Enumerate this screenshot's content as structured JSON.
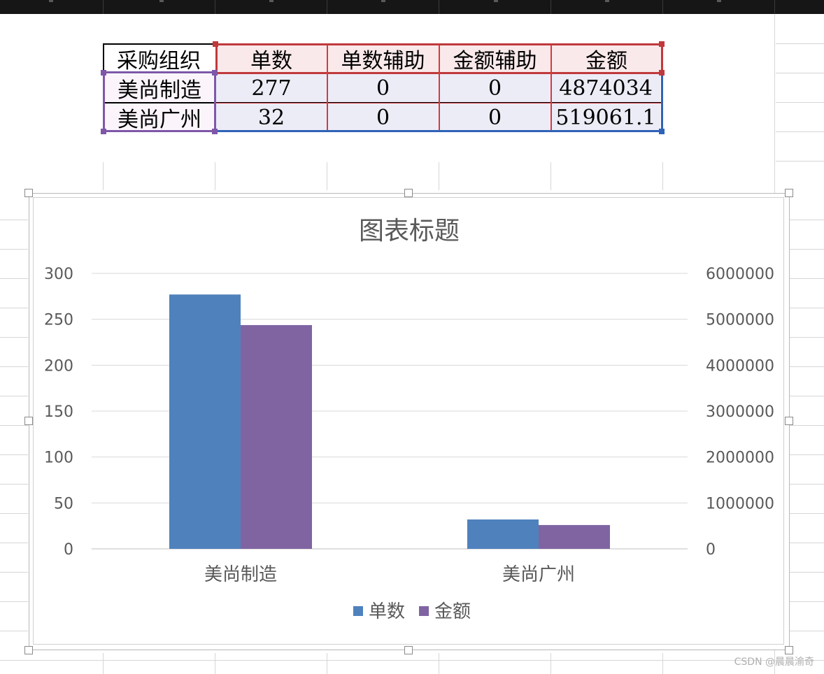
{
  "table": {
    "headers": [
      "采购组织",
      "单数",
      "单数辅助",
      "金额辅助",
      "金额"
    ],
    "rows": [
      {
        "org": "美尚制造",
        "count": "277",
        "count_aux": "0",
        "amount_aux": "0",
        "amount": "4874034"
      },
      {
        "org": "美尚广州",
        "count": "32",
        "count_aux": "0",
        "amount_aux": "0",
        "amount": "519061.1"
      }
    ]
  },
  "colors": {
    "series_count": "#4f81bd",
    "series_amount": "#8064a2",
    "ref_red": "#c0393b",
    "ref_purple": "#7e57a8",
    "ref_blue": "#2f63b7"
  },
  "chart_data": {
    "type": "bar",
    "title": "图表标题",
    "categories": [
      "美尚制造",
      "美尚广州"
    ],
    "series": [
      {
        "name": "单数",
        "axis": "left",
        "values": [
          277,
          32
        ]
      },
      {
        "name": "金额",
        "axis": "right",
        "values": [
          4874034,
          519061.1
        ]
      }
    ],
    "ylim_left": [
      0,
      300
    ],
    "yticks_left": [
      "0",
      "50",
      "100",
      "150",
      "200",
      "250",
      "300"
    ],
    "ylim_right": [
      0,
      6000000
    ],
    "yticks_right": [
      "0",
      "1000000",
      "2000000",
      "3000000",
      "4000000",
      "5000000",
      "6000000"
    ],
    "grid": true,
    "legend": "bottom"
  },
  "watermark": "CSDN @晨晨渝奇"
}
